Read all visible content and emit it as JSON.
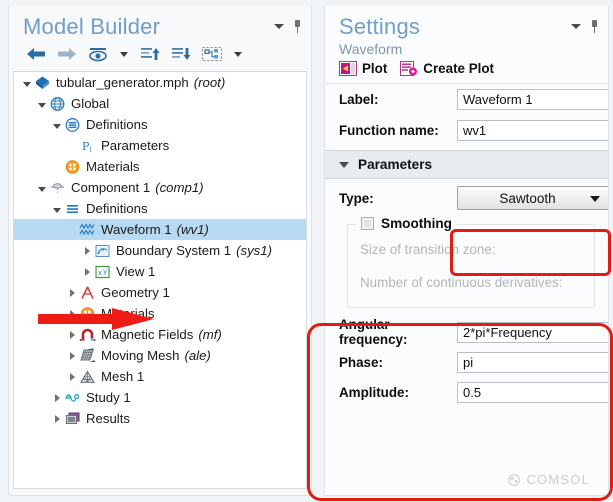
{
  "model_builder": {
    "title": "Model Builder",
    "header_icons": [
      "chevron-down-icon",
      "pin-icon"
    ],
    "toolbar": [
      {
        "name": "back-icon",
        "label": "Back"
      },
      {
        "name": "forward-icon",
        "label": "Forward"
      },
      {
        "name": "show-hide-icon",
        "label": "Show"
      },
      {
        "name": "show-dropdown-caret-icon",
        "label": ""
      },
      {
        "name": "collapse-up-icon",
        "label": "Collapse"
      },
      {
        "name": "expand-down-icon",
        "label": "Expand"
      },
      {
        "name": "node-group-icon",
        "label": "Group"
      },
      {
        "name": "group-dropdown-caret-icon",
        "label": ""
      }
    ],
    "tree": [
      {
        "label": "tubular_generator.mph",
        "tag": "(root)",
        "depth": 0,
        "twisty": "open",
        "icon": "root-model-icon",
        "selected": false
      },
      {
        "label": "Global",
        "tag": "",
        "depth": 1,
        "twisty": "open",
        "icon": "global-globe-icon",
        "selected": false
      },
      {
        "label": "Definitions",
        "tag": "",
        "depth": 2,
        "twisty": "open",
        "icon": "definitions-icon",
        "selected": false
      },
      {
        "label": "Parameters",
        "tag": "",
        "depth": 3,
        "twisty": "none",
        "icon": "parameters-pi-icon",
        "selected": false
      },
      {
        "label": "Materials",
        "tag": "",
        "depth": 2,
        "twisty": "none",
        "icon": "materials-icon",
        "selected": false
      },
      {
        "label": "Component 1",
        "tag": "(comp1)",
        "depth": 1,
        "twisty": "open",
        "icon": "component-icon",
        "selected": false
      },
      {
        "label": "Definitions",
        "tag": "",
        "depth": 2,
        "twisty": "open",
        "icon": "definitions-comp-icon",
        "selected": false
      },
      {
        "label": "Waveform 1",
        "tag": "(wv1)",
        "depth": 3,
        "twisty": "none",
        "icon": "waveform-icon",
        "selected": true
      },
      {
        "label": "Boundary System 1",
        "tag": "(sys1)",
        "depth": 4,
        "twisty": "closed",
        "icon": "boundary-system-icon",
        "selected": false
      },
      {
        "label": "View 1",
        "tag": "",
        "depth": 4,
        "twisty": "closed",
        "icon": "view-icon",
        "selected": false
      },
      {
        "label": "Geometry 1",
        "tag": "",
        "depth": 3,
        "twisty": "closed",
        "icon": "geometry-icon",
        "selected": false
      },
      {
        "label": "Materials",
        "tag": "",
        "depth": 3,
        "twisty": "closed",
        "icon": "materials-icon",
        "selected": false
      },
      {
        "label": "Magnetic Fields",
        "tag": "(mf)",
        "depth": 3,
        "twisty": "closed",
        "icon": "magnetic-fields-icon",
        "selected": false
      },
      {
        "label": "Moving Mesh",
        "tag": "(ale)",
        "depth": 3,
        "twisty": "closed",
        "icon": "moving-mesh-icon",
        "selected": false
      },
      {
        "label": "Mesh 1",
        "tag": "",
        "depth": 3,
        "twisty": "closed",
        "icon": "mesh-icon",
        "selected": false
      },
      {
        "label": "Study 1",
        "tag": "",
        "depth": 2,
        "twisty": "closed",
        "icon": "study-icon",
        "selected": false
      },
      {
        "label": "Results",
        "tag": "",
        "depth": 2,
        "twisty": "closed",
        "icon": "results-icon",
        "selected": false
      }
    ]
  },
  "settings": {
    "title": "Settings",
    "subtitle": "Waveform",
    "header_icons": [
      "chevron-down-icon",
      "pin-icon"
    ],
    "actions": [
      {
        "label": "Plot",
        "icon": "plot-icon"
      },
      {
        "label": "Create Plot",
        "icon": "create-plot-icon"
      }
    ],
    "fields": [
      {
        "label": "Label:",
        "value": "Waveform 1",
        "name": "label-field"
      },
      {
        "label": "Function name:",
        "value": "wv1",
        "name": "function-name-field"
      }
    ],
    "parameters_section": {
      "title": "Parameters",
      "type_label": "Type:",
      "type_value": "Sawtooth",
      "smoothing_label": "Smoothing",
      "smoothing_checked": false,
      "disabled_fields": [
        "Size of transition zone:",
        "Number of continuous derivatives:"
      ],
      "rows": [
        {
          "label": "Angular frequency:",
          "value": "2*pi*Frequency",
          "name": "angular-frequency-field"
        },
        {
          "label": "Phase:",
          "value": "pi",
          "name": "phase-field"
        },
        {
          "label": "Amplitude:",
          "value": "0.5",
          "name": "amplitude-field"
        }
      ]
    },
    "watermark": "COMSOL"
  },
  "annotations": {
    "arrow_color": "#ee1c15",
    "box_color": "#e41b13",
    "selection_color": "#b7daf2"
  }
}
